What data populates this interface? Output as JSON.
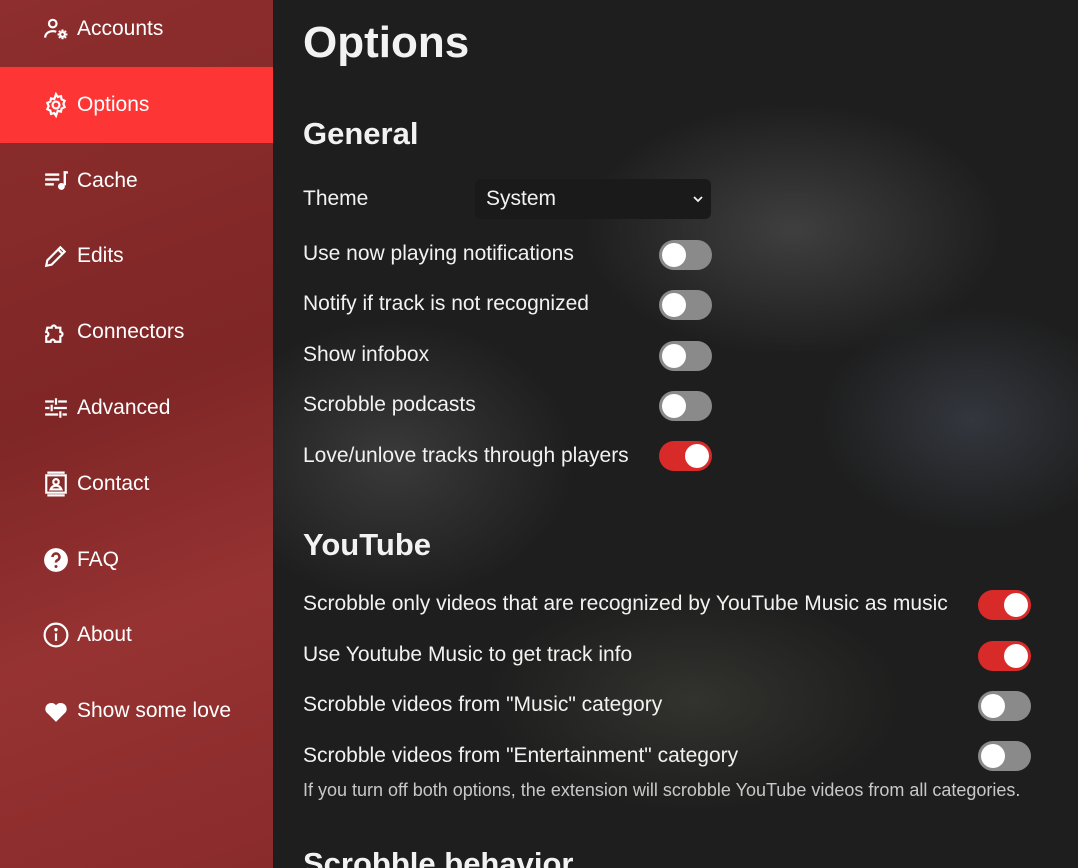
{
  "sidebar": {
    "items": [
      {
        "label": "Accounts",
        "icon": "account-settings-icon"
      },
      {
        "label": "Options",
        "icon": "gear-icon",
        "active": true
      },
      {
        "label": "Cache",
        "icon": "playlist-music-icon"
      },
      {
        "label": "Edits",
        "icon": "pencil-icon"
      },
      {
        "label": "Connectors",
        "icon": "puzzle-icon"
      },
      {
        "label": "Advanced",
        "icon": "sliders-icon"
      },
      {
        "label": "Contact",
        "icon": "contact-card-icon"
      },
      {
        "label": "FAQ",
        "icon": "question-circle-icon"
      },
      {
        "label": "About",
        "icon": "info-circle-icon"
      },
      {
        "label": "Show some love",
        "icon": "heart-icon"
      }
    ],
    "active_color": "#fe3535"
  },
  "main": {
    "title": "Options",
    "general": {
      "title": "General",
      "theme_label": "Theme",
      "theme_value": "System",
      "toggles": [
        {
          "label": "Use now playing notifications",
          "on": false
        },
        {
          "label": "Notify if track is not recognized",
          "on": false
        },
        {
          "label": "Show infobox",
          "on": false
        },
        {
          "label": "Scrobble podcasts",
          "on": false
        },
        {
          "label": "Love/unlove tracks through players",
          "on": true
        }
      ]
    },
    "youtube": {
      "title": "YouTube",
      "toggles": [
        {
          "label": "Scrobble only videos that are recognized by YouTube Music as music",
          "on": true
        },
        {
          "label": "Use Youtube Music to get track info",
          "on": true
        },
        {
          "label": "Scrobble videos from \"Music\" category",
          "on": false
        },
        {
          "label": "Scrobble videos from \"Entertainment\" category",
          "on": false
        }
      ],
      "hint": "If you turn off both options, the extension will scrobble YouTube videos from all categories."
    },
    "scrobble_behavior": {
      "title": "Scrobble behavior"
    }
  },
  "colors": {
    "toggle_on": "#d92a2a",
    "toggle_off": "#8a8a8a"
  }
}
